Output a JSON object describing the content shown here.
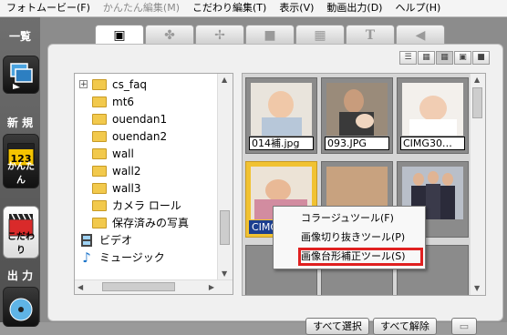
{
  "menubar": {
    "items": [
      {
        "label": "フォトムービー(F)",
        "enabled": true
      },
      {
        "label": "かんたん編集(M)",
        "enabled": false
      },
      {
        "label": "こだわり編集(T)",
        "enabled": true
      },
      {
        "label": "表示(V)",
        "enabled": true
      },
      {
        "label": "動画出力(D)",
        "enabled": true
      },
      {
        "label": "ヘルプ(H)",
        "enabled": true
      }
    ]
  },
  "sidebar": {
    "overview_label": "一覧",
    "new_label": "新 規",
    "easy_label": "かんたん",
    "custom_label": "こだわり",
    "output_label": "出 力",
    "easy_icon_text": "123"
  },
  "view_buttons": [
    "list-view",
    "small-grid-view",
    "medium-grid-view",
    "large-grid-view",
    "xlarge-grid-view"
  ],
  "folder_tree": {
    "items": [
      {
        "label": "cs_faq",
        "icon": "folder-icon",
        "expander": "+"
      },
      {
        "label": "mt6",
        "icon": "folder-icon"
      },
      {
        "label": "ouendan1",
        "icon": "folder-icon"
      },
      {
        "label": "ouendan2",
        "icon": "folder-icon"
      },
      {
        "label": "wall",
        "icon": "folder-icon"
      },
      {
        "label": "wall2",
        "icon": "folder-icon"
      },
      {
        "label": "wall3",
        "icon": "folder-icon"
      },
      {
        "label": "カメラ ロール",
        "icon": "folder-icon"
      },
      {
        "label": "保存済みの写真",
        "icon": "folder-icon"
      },
      {
        "label": "ビデオ",
        "icon": "video-icon"
      },
      {
        "label": "ミュージック",
        "icon": "music-note-icon"
      }
    ]
  },
  "thumbnails": [
    {
      "label": "014補.jpg",
      "selected": false,
      "color": "#d9c3b0"
    },
    {
      "label": "093.JPG",
      "selected": false,
      "color": "#7a5a49"
    },
    {
      "label": "CIMG30…",
      "selected": false,
      "color": "#e6d9ce"
    },
    {
      "label": "CIMG",
      "selected": true,
      "color": "#d7b99a"
    },
    {
      "label": "",
      "selected": false,
      "color": "#c8a27f"
    },
    {
      "label": "",
      "selected": false,
      "color": "#8a8aa3"
    }
  ],
  "context_menu": {
    "items": [
      "コラージュツール(F)",
      "画像切り抜きツール(P)",
      "画像台形補正ツール(S)"
    ],
    "highlight_color": "#e02020"
  },
  "buttons": {
    "select_all": "すべて選択",
    "deselect_all": "すべて解除"
  }
}
